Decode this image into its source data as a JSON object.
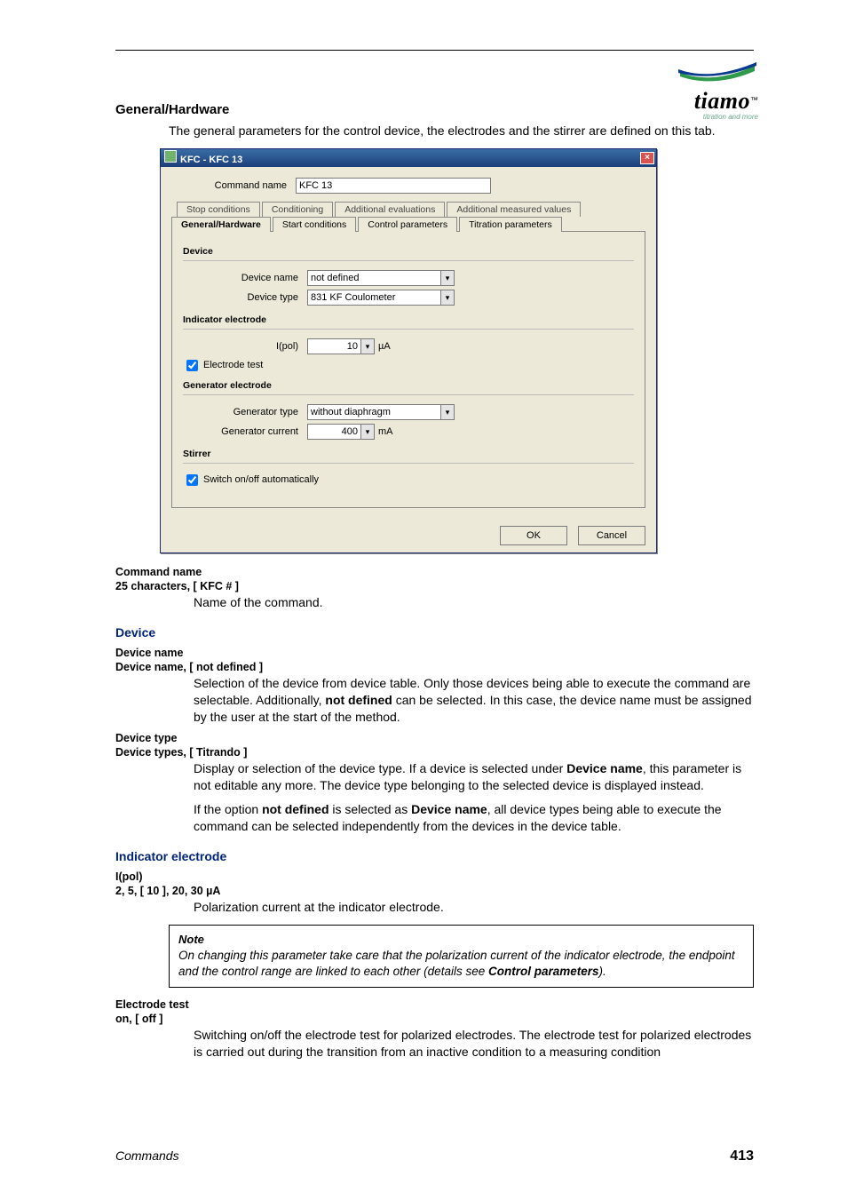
{
  "brand": {
    "name": "tiamo",
    "tm": "™",
    "tagline": "titration and more"
  },
  "sections": {
    "general_hardware_title": "General/Hardware",
    "general_hardware_intro": "The general parameters for the control device, the electrodes and the stirrer are defined on this tab.",
    "device_title": "Device",
    "indicator_electrode_title": "Indicator electrode"
  },
  "dialog": {
    "title": "KFC - KFC 13",
    "command_name_label": "Command name",
    "command_name_value": "KFC 13",
    "tabs_back": [
      "Stop conditions",
      "Conditioning",
      "Additional evaluations",
      "Additional measured values"
    ],
    "tabs_front": [
      "General/Hardware",
      "Start conditions",
      "Control parameters",
      "Titration parameters"
    ],
    "active_tab": "General/Hardware",
    "groups": {
      "device": {
        "title": "Device",
        "device_name_label": "Device name",
        "device_name_value": "not defined",
        "device_type_label": "Device type",
        "device_type_value": "831 KF Coulometer"
      },
      "indicator": {
        "title": "Indicator electrode",
        "ipol_label": "I(pol)",
        "ipol_value": "10",
        "ipol_unit": "µA",
        "electrode_test_label": "Electrode test",
        "electrode_test_checked": true
      },
      "generator": {
        "title": "Generator electrode",
        "type_label": "Generator type",
        "type_value": "without diaphragm",
        "current_label": "Generator current",
        "current_value": "400",
        "current_unit": "mA"
      },
      "stirrer": {
        "title": "Stirrer",
        "auto_label": "Switch on/off automatically",
        "auto_checked": true
      }
    },
    "buttons": {
      "ok": "OK",
      "cancel": "Cancel"
    }
  },
  "params": {
    "command_name": {
      "name": "Command name",
      "values": "25 characters, [ KFC # ]",
      "desc": "Name of the command."
    },
    "device_name": {
      "name": "Device name",
      "values": "Device name, [ not defined ]",
      "desc_pre": "Selection of the device from device table. Only those devices being able to execute the command are selectable. Additionally, ",
      "desc_bold": "not defined",
      "desc_post": " can be selected. In this case, the device name must be assigned by the user at the start of the method."
    },
    "device_type": {
      "name": "Device type",
      "values": "Device types, [ Titrando ]",
      "p1_pre": "Display or selection of the device type. If a device is selected under ",
      "p1_b1": "Device name",
      "p1_post": ", this parameter is not editable any more. The device type belonging to the selected device is displayed instead.",
      "p2_pre": "If the option ",
      "p2_b1": "not defined",
      "p2_mid": " is selected as ",
      "p2_b2": "Device name",
      "p2_post": ", all device types being able to execute the command can be selected independently from the devices in the device table."
    },
    "ipol": {
      "name": "I(pol)",
      "values": "2, 5, [ 10 ], 20, 30 µA",
      "desc": "Polarization current at the indicator electrode."
    },
    "note": {
      "title": "Note",
      "body_pre": "On changing this parameter take care that the polarization current of the indicator electrode, the endpoint and the control range are linked to each other (details see ",
      "body_b": "Control parameters",
      "body_post": ")."
    },
    "electrode_test": {
      "name": "Electrode test",
      "values": "on, [ off ]",
      "desc": "Switching on/off the electrode test for polarized electrodes. The electrode test for polarized electrodes is carried out during the transition from an inactive condition to a measuring condition"
    }
  },
  "footer": {
    "left": "Commands",
    "right": "413"
  }
}
